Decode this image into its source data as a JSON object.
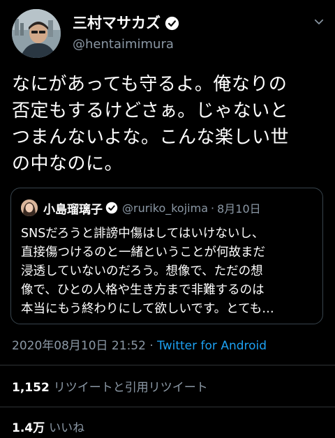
{
  "author": {
    "name": "三村マサカズ",
    "handle": "@hentaimimura",
    "verified": true
  },
  "tweet": {
    "text": "なにがあっても守るよ。俺なりの\n否定もするけどさぁ。じゃないと\nつまんないよな。こんな楽しい世\nの中なのに。"
  },
  "quote": {
    "name": "小島瑠璃子",
    "handle": "@ruriko_kojima",
    "separator": "·",
    "date": "8月10日",
    "text": "SNSだろうと誹謗中傷はしてはいけないし、\n直接傷つけるのと一緒ということが何故まだ\n浸透していないのだろう。想像で、ただの想\n像で、ひとの人格や生き方まで非難するのは\n本当にもう終わりにして欲しいです。とても…"
  },
  "meta": {
    "timestamp": "2020年08月10日 21:52",
    "separator": "·",
    "source": "Twitter for Android"
  },
  "stats": {
    "retweets_count": "1,152",
    "retweets_label": "リツイートと引用リツイート",
    "likes_count": "1.4万",
    "likes_label": "いいね"
  },
  "colors": {
    "background": "#000000",
    "text": "#ffffff",
    "muted": "#8b98a5",
    "accent": "#1da1f2",
    "border": "#38444d"
  },
  "icons": {
    "verified": "verified-badge-icon",
    "more": "chevron-down-icon"
  }
}
